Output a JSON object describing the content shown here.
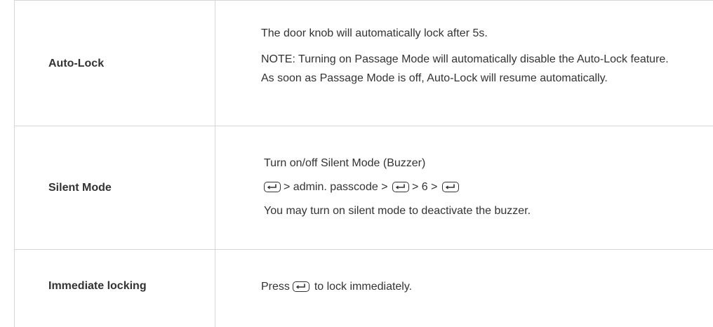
{
  "rows": [
    {
      "label": "Auto-Lock",
      "lines": [
        "The door knob will automatically lock after 5s.",
        "NOTE: Turning on Passage Mode will automatically disable the Auto-Lock feature. As soon as Passage Mode is off, Auto-Lock will resume automatically."
      ]
    },
    {
      "label": "Silent Mode",
      "title": "Turn on/off Silent Mode (Buzzer)",
      "sequence": {
        "step1": "> admin. passcode >",
        "step2": "> 6 >"
      },
      "note": "You may turn on silent mode to deactivate the buzzer."
    },
    {
      "label": "Immediate locking",
      "prefix": "Press",
      "suffix": "to lock immediately."
    }
  ],
  "icons": {
    "enter_key": "enter-key-icon"
  },
  "colors": {
    "text": "#333333",
    "border": "#d6d6d6"
  }
}
